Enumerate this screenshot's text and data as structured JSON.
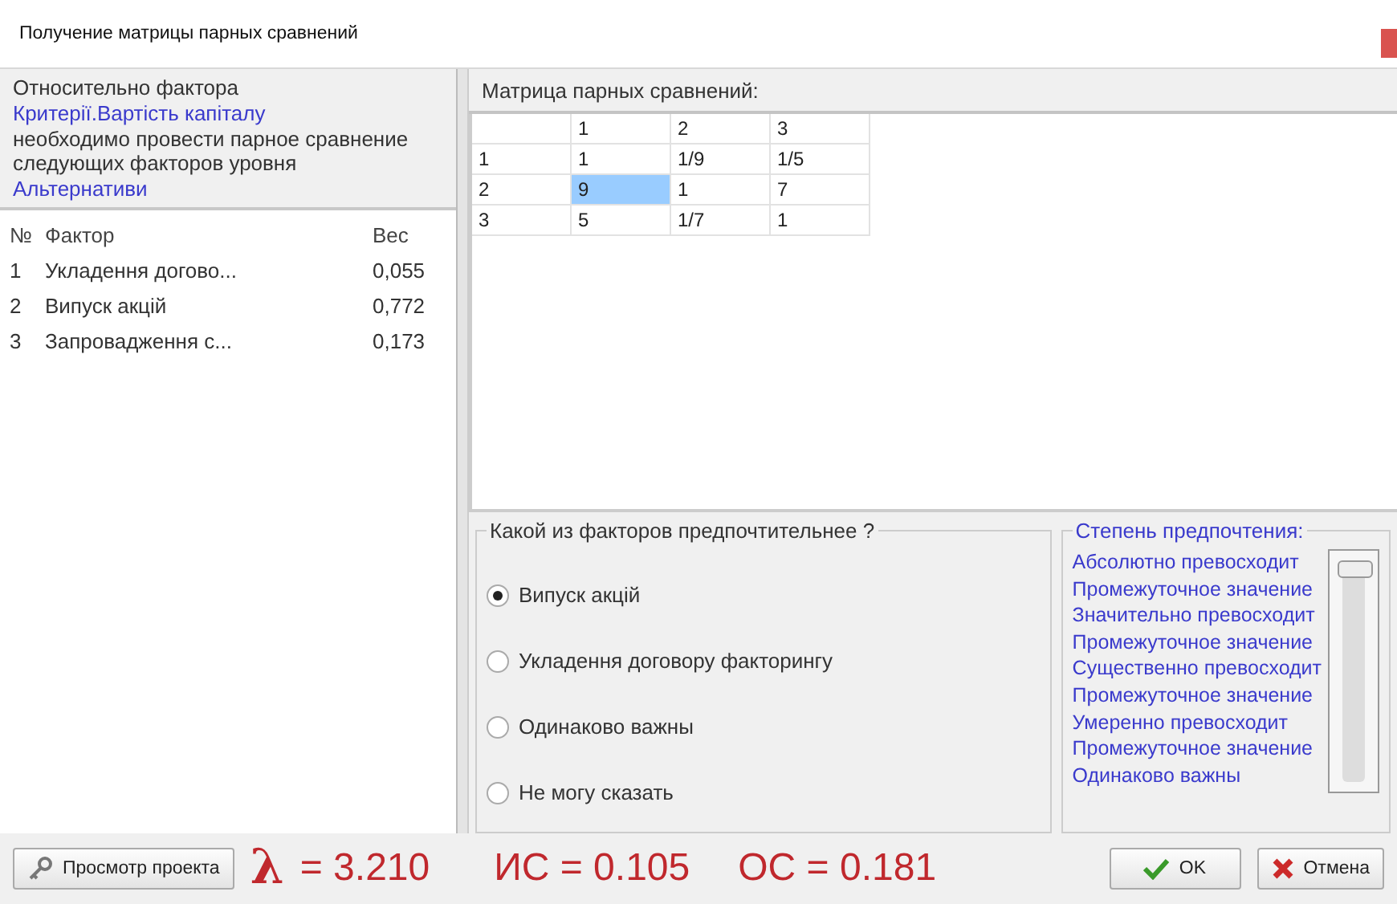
{
  "window": {
    "title": "Получение матрицы парных сравнений"
  },
  "info": {
    "prefix": "Относительно фактора",
    "factor": "Критерії.Вартість капіталу",
    "text": "необходимо провести парное сравнение следующих факторов уровня",
    "level_name": "Альтернативи"
  },
  "factors": {
    "columns": [
      "№",
      "Фактор",
      "Вес"
    ],
    "rows": [
      {
        "num": "1",
        "name": "Укладення догово...",
        "weight": "0,055"
      },
      {
        "num": "2",
        "name": "Випуск акцій",
        "weight": "0,772"
      },
      {
        "num": "3",
        "name": "Запровадження с...",
        "weight": "0,173"
      }
    ]
  },
  "matrix": {
    "title": "Матрица парных сравнений:",
    "columns": [
      "1",
      "2",
      "3"
    ],
    "rows": [
      {
        "label": "1",
        "cells": [
          {
            "value": "1",
            "selected": false
          },
          {
            "value": "1/9",
            "selected": false
          },
          {
            "value": "1/5",
            "selected": false
          }
        ]
      },
      {
        "label": "2",
        "cells": [
          {
            "value": "9",
            "selected": true
          },
          {
            "value": "1",
            "selected": false
          },
          {
            "value": "7",
            "selected": false
          }
        ]
      },
      {
        "label": "3",
        "cells": [
          {
            "value": "5",
            "selected": false
          },
          {
            "value": "1/7",
            "selected": false
          },
          {
            "value": "1",
            "selected": false
          }
        ]
      }
    ]
  },
  "preference": {
    "title": "Какой из факторов предпочтительнее ?",
    "options": [
      {
        "label": "Випуск акцій",
        "selected": true
      },
      {
        "label": "Укладення договору факторингу",
        "selected": false
      },
      {
        "label": "Одинаково важны",
        "selected": false
      },
      {
        "label": "Не могу сказать",
        "selected": false
      }
    ]
  },
  "degree": {
    "title": "Степень предпочтения:",
    "level": 1,
    "labels": [
      "Абсолютно превосходит",
      "Промежуточное значение",
      "Значительно превосходит",
      "Промежуточное значение",
      "Существенно превосходит",
      "Промежуточное значение",
      "Умеренно превосходит",
      "Промежуточное значение",
      "Одинаково важны"
    ]
  },
  "footer": {
    "view_button": "Просмотр проекта",
    "lambda_symbol": "λ",
    "lambda_value": "= 3.210",
    "ci": "ИС = 0.105",
    "cr": "ОС = 0.181",
    "ok_button": "OK",
    "cancel_button": "Отмена"
  }
}
